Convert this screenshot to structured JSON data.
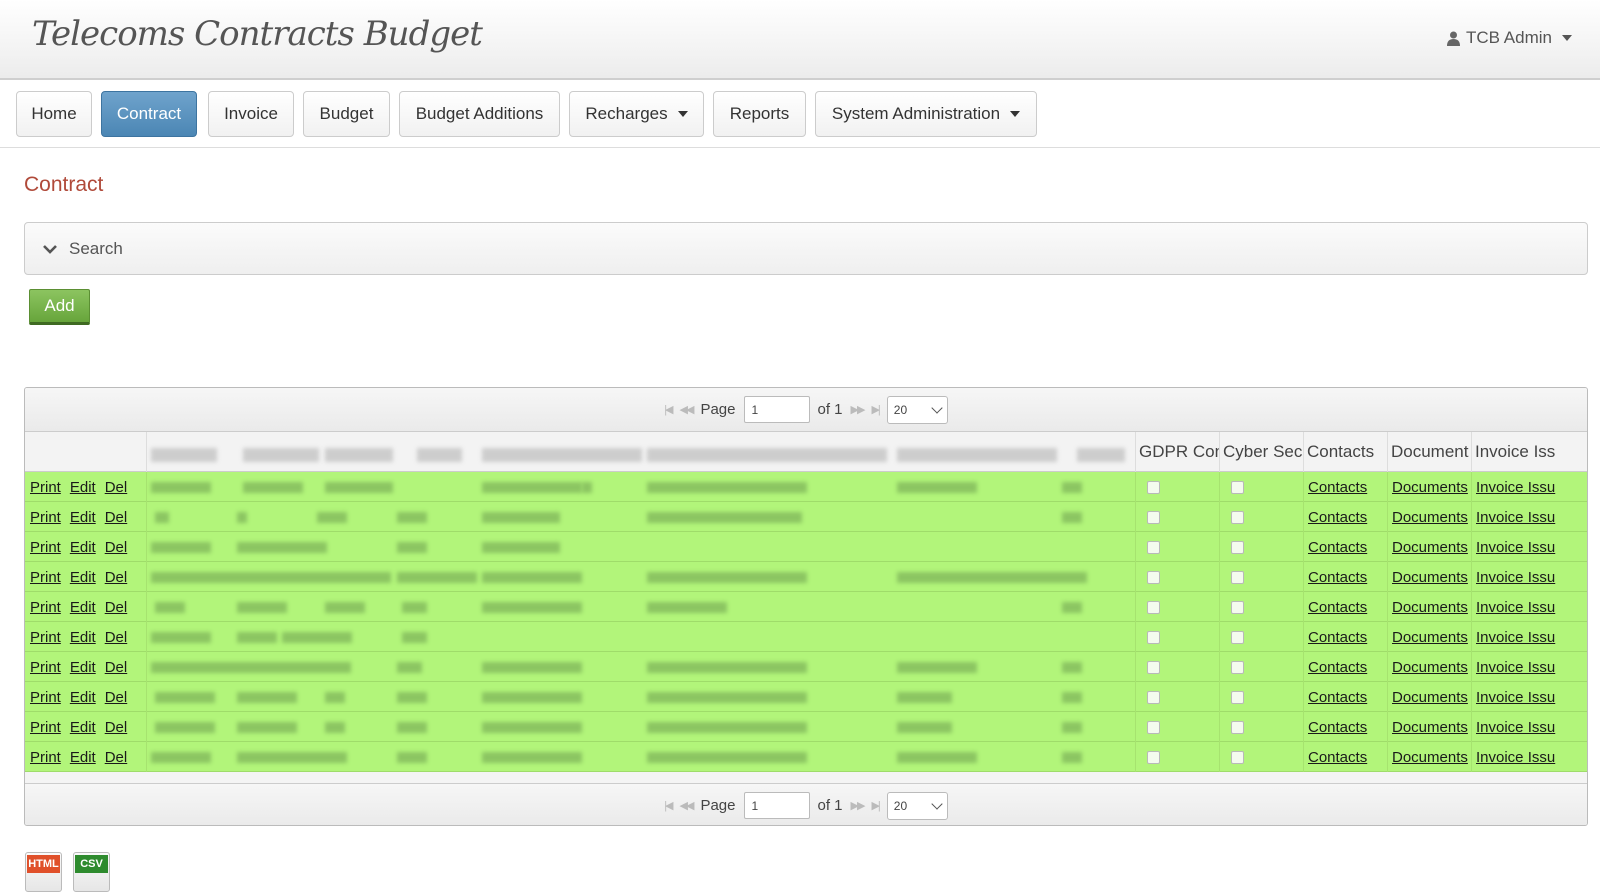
{
  "app": {
    "logo_text": "Telecoms Contracts Budget",
    "user_label": "TCB Admin"
  },
  "nav": {
    "items": [
      {
        "label": "Home",
        "active": false,
        "dropdown": false
      },
      {
        "label": "Contract",
        "active": true,
        "dropdown": false
      },
      {
        "label": "Invoice",
        "active": false,
        "dropdown": false
      },
      {
        "label": "Budget",
        "active": false,
        "dropdown": false
      },
      {
        "label": "Budget Additions",
        "active": false,
        "dropdown": false
      },
      {
        "label": "Recharges",
        "active": false,
        "dropdown": true
      },
      {
        "label": "Reports",
        "active": false,
        "dropdown": false
      },
      {
        "label": "System Administration",
        "active": false,
        "dropdown": true
      }
    ]
  },
  "page": {
    "title": "Contract"
  },
  "search": {
    "label": "Search"
  },
  "add_button": {
    "label": "Add"
  },
  "pager": {
    "page_label": "Page",
    "page_value": "1",
    "of_label": "of 1",
    "page_size": "20"
  },
  "table": {
    "columns": [
      "GDPR Con",
      "Cyber Sec",
      "Contacts",
      "Document",
      "Invoice Iss"
    ],
    "row_actions": [
      "Print",
      "Edit",
      "Del"
    ],
    "link_labels": {
      "contacts": "Contacts",
      "documents": "Documents",
      "invoice": "Invoice Issu"
    },
    "row_count": 10
  },
  "exports": [
    {
      "label": "HTML",
      "color": "#e0502a"
    },
    {
      "label": "CSV",
      "color": "#2e8b2e"
    }
  ],
  "colors": {
    "accent": "#4b86b4",
    "row_highlight": "#b2f57a",
    "title": "#b04a3a",
    "add_button": "#67a53b"
  }
}
